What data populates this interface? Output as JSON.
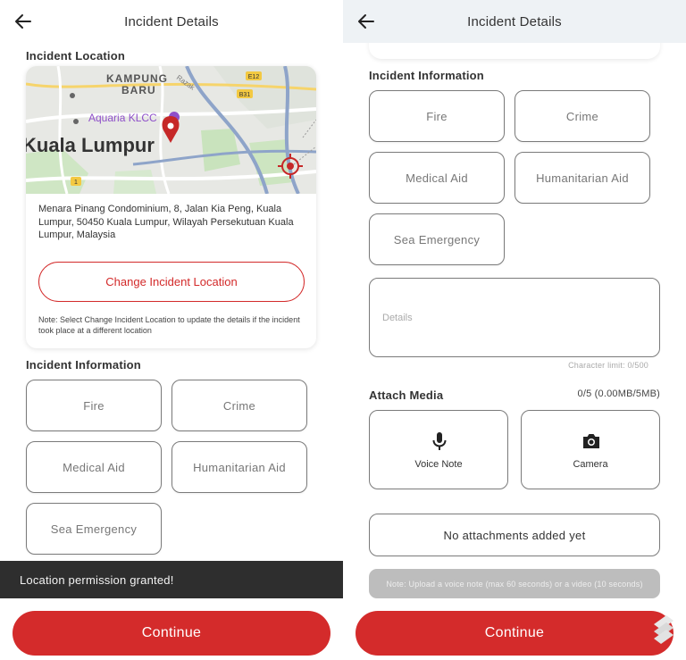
{
  "left": {
    "header": {
      "title": "Incident Details"
    },
    "location": {
      "label": "Incident Location",
      "map": {
        "place_kampung": "KAMPUNG",
        "place_baru": "BARU",
        "place_aquaria": "Aquaria KLCC",
        "place_kl": "Kuala Lumpur",
        "road_e12": "E12",
        "road_b31": "B31",
        "road_1": "1",
        "road_razak": "Razak"
      },
      "address": "Menara Pinang Condominium, 8, Jalan Kia Peng, Kuala Lumpur, 50450 Kuala Lumpur, Wilayah Persekutuan Kuala Lumpur, Malaysia",
      "change_button": "Change Incident Location",
      "note": "Note: Select Change Incident Location to update the details if the incident took place at a different location"
    },
    "info": {
      "label": "Incident Information",
      "categories": [
        "Fire",
        "Crime",
        "Medical Aid",
        "Humanitarian Aid",
        "Sea Emergency"
      ]
    },
    "toast": "Location permission granted!",
    "continue": "Continue"
  },
  "right": {
    "header": {
      "title": "Incident Details"
    },
    "info": {
      "label": "Incident Information",
      "categories": [
        "Fire",
        "Crime",
        "Medical Aid",
        "Humanitarian Aid",
        "Sea Emergency"
      ]
    },
    "details": {
      "placeholder": "Details",
      "char_limit": "Character limit: 0/500"
    },
    "media": {
      "label": "Attach Media",
      "count": "0/5 (0.00MB/5MB)",
      "voice_note": "Voice Note",
      "camera": "Camera",
      "no_attachments": "No attachments added yet",
      "upload_note": "Note: Upload a voice note (max 60 seconds) or a video (10 seconds)"
    },
    "continue": "Continue"
  },
  "colors": {
    "accent": "#d42b2b",
    "toast_bg": "#2e2e2e",
    "border": "#7a7a7a",
    "map_pin": "#c62828"
  },
  "icons": {
    "back": "arrow-left-icon",
    "pin": "map-pin-icon",
    "target": "crosshair-target-icon",
    "mic": "microphone-icon",
    "camera": "camera-icon"
  }
}
